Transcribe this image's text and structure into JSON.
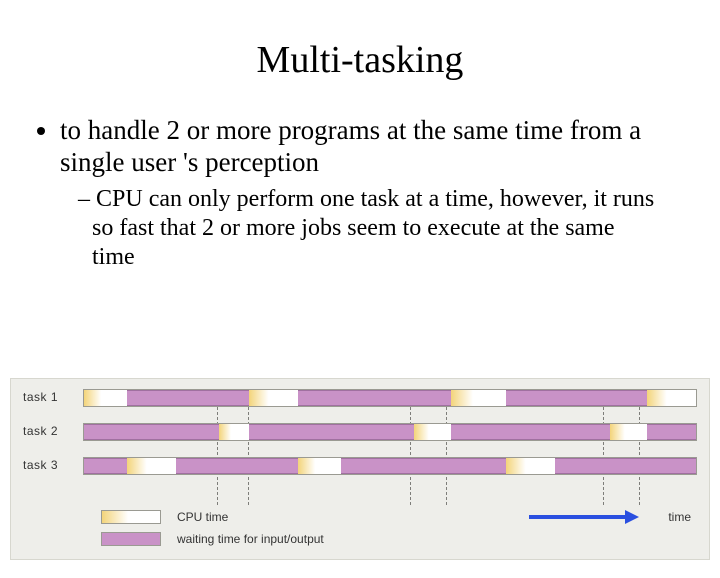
{
  "title": "Multi-tasking",
  "bullets": {
    "main": "to handle 2 or more programs at the same time from a single user 's perception",
    "sub": "CPU can only perform one task at a time, however, it runs so fast that 2 or more jobs seem to execute at the same time"
  },
  "chart_data": {
    "type": "timeline",
    "x_unit": "percent",
    "tasks": [
      {
        "label": "task 1",
        "segments": [
          {
            "state": "cpu",
            "start": 0,
            "end": 7
          },
          {
            "state": "wait",
            "start": 7,
            "end": 27
          },
          {
            "state": "cpu",
            "start": 27,
            "end": 35
          },
          {
            "state": "wait",
            "start": 35,
            "end": 60
          },
          {
            "state": "cpu",
            "start": 60,
            "end": 69
          },
          {
            "state": "wait",
            "start": 69,
            "end": 92
          },
          {
            "state": "cpu",
            "start": 92,
            "end": 100
          }
        ]
      },
      {
        "label": "task 2",
        "segments": [
          {
            "state": "wait",
            "start": 0,
            "end": 22
          },
          {
            "state": "cpu",
            "start": 22,
            "end": 27
          },
          {
            "state": "wait",
            "start": 27,
            "end": 54
          },
          {
            "state": "cpu",
            "start": 54,
            "end": 60
          },
          {
            "state": "wait",
            "start": 60,
            "end": 86
          },
          {
            "state": "cpu",
            "start": 86,
            "end": 92
          },
          {
            "state": "wait",
            "start": 92,
            "end": 100
          }
        ]
      },
      {
        "label": "task 3",
        "segments": [
          {
            "state": "wait",
            "start": 0,
            "end": 7
          },
          {
            "state": "cpu",
            "start": 7,
            "end": 15
          },
          {
            "state": "wait",
            "start": 15,
            "end": 35
          },
          {
            "state": "cpu",
            "start": 35,
            "end": 42
          },
          {
            "state": "wait",
            "start": 42,
            "end": 69
          },
          {
            "state": "cpu",
            "start": 69,
            "end": 77
          },
          {
            "state": "wait",
            "start": 77,
            "end": 100
          }
        ]
      }
    ],
    "context_switch_lines": [
      22,
      27,
      54,
      60,
      86,
      92
    ],
    "legend": {
      "cpu": "CPU time",
      "wait": "waiting time for input/output",
      "axis": "time"
    }
  }
}
